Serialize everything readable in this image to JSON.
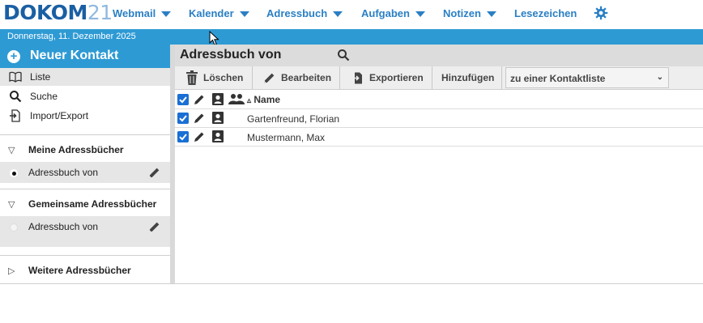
{
  "brand": {
    "logo_main": "DOKOM",
    "logo_suffix": "21"
  },
  "nav": {
    "items": [
      {
        "label": "Webmail",
        "has_dropdown": true
      },
      {
        "label": "Kalender",
        "has_dropdown": true
      },
      {
        "label": "Adressbuch",
        "has_dropdown": true
      },
      {
        "label": "Aufgaben",
        "has_dropdown": true
      },
      {
        "label": "Notizen",
        "has_dropdown": true
      },
      {
        "label": "Lesezeichen",
        "has_dropdown": false
      }
    ],
    "settings_icon": "gear-icon"
  },
  "date_bar": {
    "text": "Donnerstag, 11. Dezember 2025"
  },
  "sidebar": {
    "new_contact": {
      "label": "Neuer Kontakt",
      "icon": "plus-circle-icon"
    },
    "items": [
      {
        "label": "Liste",
        "icon": "book-icon",
        "active": true
      },
      {
        "label": "Suche",
        "icon": "search-icon",
        "active": false
      },
      {
        "label": "Import/Export",
        "icon": "import-icon",
        "active": false
      }
    ],
    "sections": [
      {
        "title": "Meine Adressbücher",
        "expanded": true,
        "books": [
          {
            "label": "Adressbuch von",
            "selected": true
          }
        ]
      },
      {
        "title": "Gemeinsame Adressbücher",
        "expanded": true,
        "books": [
          {
            "label": "Adressbuch von",
            "selected": false
          }
        ]
      },
      {
        "title": "Weitere Adressbücher",
        "expanded": false,
        "books": []
      }
    ]
  },
  "main": {
    "title": "Adressbuch von",
    "toolbar": {
      "delete_label": "Löschen",
      "edit_label": "Bearbeiten",
      "export_label": "Exportieren",
      "add_label": "Hinzufügen",
      "contactlist_select": "zu einer Kontaktliste"
    },
    "table": {
      "header": {
        "name_label": "Name",
        "sort_indicator": "▵"
      },
      "rows": [
        {
          "name": "Gartenfreund, Florian",
          "checked": true
        },
        {
          "name": "Mustermann, Max",
          "checked": true
        }
      ]
    }
  },
  "colors": {
    "accent": "#2e9ad4",
    "nav_text": "#2a7fc4",
    "logo_dark": "#1a5fa3",
    "logo_light": "#8fb9df",
    "checkbox": "#1a6fd4"
  }
}
